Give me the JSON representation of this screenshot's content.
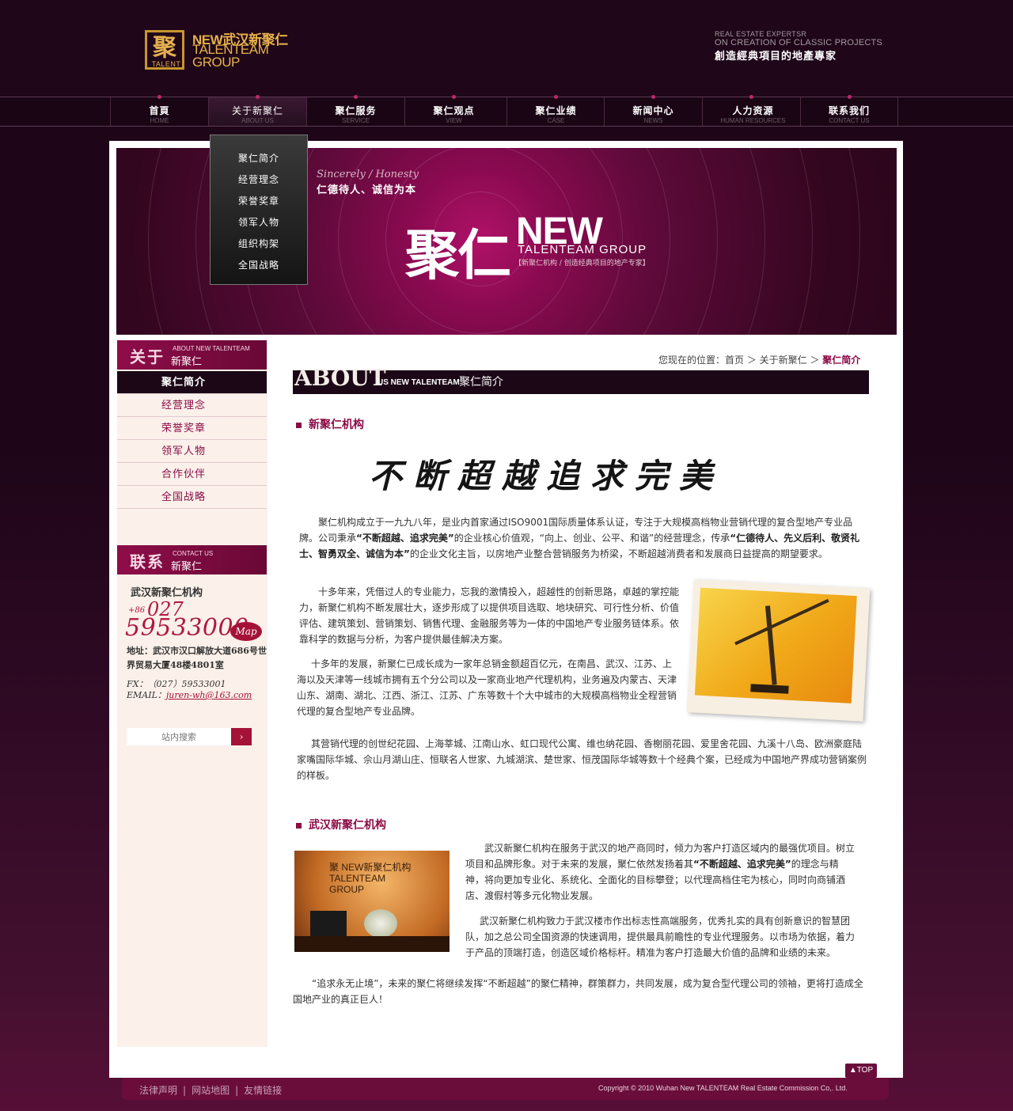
{
  "header": {
    "logo": {
      "box": "聚",
      "sub": "TALENT",
      "line1": "NEW武汉新聚仁",
      "line2": "TALENTEAM",
      "line3": "GROUP"
    },
    "slogan": {
      "line1": "REAL ESTATE EXPERTSR",
      "line2": "ON CREATION OF CLASSIC PROJECTS",
      "line3": "創造經典項目的地產專家"
    }
  },
  "nav": [
    {
      "zh": "首頁",
      "en": "HOME"
    },
    {
      "zh": "关于新聚仁",
      "en": "ABOUT US"
    },
    {
      "zh": "聚仁服务",
      "en": "SERVICE"
    },
    {
      "zh": "聚仁观点",
      "en": "VIEW"
    },
    {
      "zh": "聚仁业绩",
      "en": "CASE"
    },
    {
      "zh": "新闻中心",
      "en": "NEWS"
    },
    {
      "zh": "人力资源",
      "en": "HUMAN RESOURCES"
    },
    {
      "zh": "联系我们",
      "en": "CONTACT US"
    }
  ],
  "dropdown": [
    "聚仁简介",
    "经营理念",
    "荣誉奖章",
    "领军人物",
    "组织构架",
    "全国战略"
  ],
  "banner": {
    "sincere": "Sincerely / Honesty",
    "slogan": "仁德待人、诚信为本",
    "juren": "聚仁",
    "new": "NEW",
    "group": "TALENTEAM GROUP",
    "tag": "【新聚仁机构 / 创造经典项目的地产专家】"
  },
  "sidebar": {
    "about_head": {
      "big": "关于",
      "en": "ABOUT NEW TALENTEAM",
      "zh": "新聚仁"
    },
    "menu": [
      "聚仁简介",
      "经营理念",
      "荣誉奖章",
      "领军人物",
      "合作伙伴",
      "全国战略"
    ],
    "contact_head": {
      "big": "联系",
      "en": "CONTACT US",
      "zh": "新聚仁"
    },
    "company": "武汉新聚仁机构",
    "area_prefix": "+86",
    "area_code": "027",
    "phone": "59533000",
    "map_label": "Map",
    "address": "地址：武汉市汉口解放大道686号世界贸易大厦48楼4801室",
    "fax": "FX：（027）59533001",
    "email_label": "EMAIL：",
    "email": "juren-wh@163.com",
    "search_placeholder": "站内搜索"
  },
  "breadcrumb": {
    "prefix": "您现在的位置：首页 ＞ 关于新聚仁 ＞",
    "current": "聚仁简介"
  },
  "about_bar": {
    "big": "ABOUT",
    "en": "US NEW TALENTEAM",
    "zh": "聚仁简介"
  },
  "section1": {
    "title": "新聚仁机构",
    "calligraphy": "不断超越追求完美",
    "p1_a": "聚仁机构成立于一九九八年，是业内首家通过ISO9001国际质量体系认证，专注于大规模高档物业营销代理的复合型地产专业品牌。公司秉承",
    "p1_b": "“不断超越、追求完美”",
    "p1_c": "的企业核心价值观，“向上、创业、公平、和谐”的经营理念，传承",
    "p1_d": "“仁德待人、先义后利、敬贤礼士、智勇双全、诚信为本”",
    "p1_e": "的企业文化主旨，以房地产业整合营销服务为桥梁，不断超越消费者和发展商日益提高的期望要求。",
    "p2": "十多年来，凭借过人的专业能力，忘我的激情投入，超越性的创新思路，卓越的掌控能力，新聚仁机构不断发展壮大，逐步形成了以提供项目选取、地块研究、可行性分析、价值评估、建筑策划、营销策划、销售代理、金融服务等为一体的中国地产专业服务链体系。依靠科学的数据与分析，为客户提供最佳解决方案。",
    "p3": "十多年的发展，新聚仁已成长成为一家年总销金额超百亿元，在南昌、武汉、江苏、上海以及天津等一线城市拥有五个分公司以及一家商业地产代理机构，业务遍及内蒙古、天津山东、湖南、湖北、江西、浙江、江苏、广东等数十个大中城市的大规模高档物业全程营销代理的复合型地产专业品牌。",
    "p4": "其营销代理的创世纪花园、上海莘城、江南山水、虹口现代公寓、维也纳花园、香榭丽花园、爱里舍花园、九溪十八岛、欧洲豪庭陆家嘴国际华城、佘山月湖山庄、恒联名人世家、九城湖滨、楚世家、恒茂国际华城等数十个经典个案，已经成为中国地产界成功营销案例的样板。"
  },
  "section2": {
    "title": "武汉新聚仁机构",
    "photo_text": "聚 NEW新聚仁机构 TALENTEAM GROUP",
    "p1_a": "武汉新聚仁机构在服务于武汉的地产商同时，倾力为客户打造区域内的最强优项目。树立项目和品牌形象。对于未来的发展，聚仁依然发扬着其",
    "p1_b": "“不断超越、追求完美”",
    "p1_c": "的理念与精神，将向更加专业化、系统化、全面化的目标攀登；以代理高档住宅为核心，同时向商铺酒店、渡假村等多元化物业发展。",
    "p2": "武汉新聚仁机构致力于武汉楼市作出标志性高端服务，优秀扎实的具有创新意识的智慧团队，加之总公司全国资源的快速调用，提供最具前瞻性的专业代理服务。以市场为依据，着力于产品的顶端打造，创造区域价格标杆。精准为客户打造最大价值的品牌和业绩的未来。",
    "p3": "“追求永无止境”，未来的聚仁将继续发挥“不断超越”的聚仁精神，群策群力，共同发展，成为复合型代理公司的领袖，更将打造成全国地产业的真正巨人！"
  },
  "footer": {
    "links": [
      "法律声明",
      "网站地图",
      "友情链接"
    ],
    "sep": "|",
    "copyright": "Copyright © 2010 Wuhan New TALENTEAM Real Estate Commission Co,. Ltd.",
    "top": "▲TOP"
  }
}
